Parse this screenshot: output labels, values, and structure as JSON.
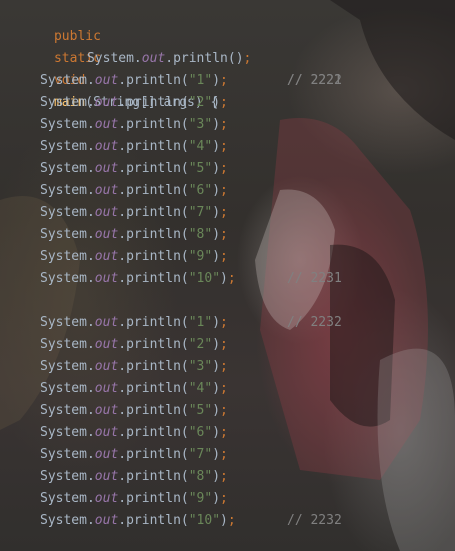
{
  "signature": {
    "kw_public": "public",
    "kw_static": "static",
    "kw_void": "void",
    "method": "main",
    "params": "(String[] args) {"
  },
  "first_call": {
    "receiver": "System.",
    "field": "out",
    "method": ".println",
    "args": "()",
    "semi": ";",
    "comment": "// 2221"
  },
  "block1": {
    "comment_first": "// 2222",
    "comment_last": "// 2231",
    "lines": [
      {
        "arg": "\"1\""
      },
      {
        "arg": "\"2\""
      },
      {
        "arg": "\"3\""
      },
      {
        "arg": "\"4\""
      },
      {
        "arg": "\"5\""
      },
      {
        "arg": "\"6\""
      },
      {
        "arg": "\"7\""
      },
      {
        "arg": "\"8\""
      },
      {
        "arg": "\"9\""
      },
      {
        "arg": "\"10\""
      }
    ]
  },
  "block2": {
    "comment_first": "// 2232",
    "comment_last": "// 2232",
    "lines": [
      {
        "arg": "\"1\""
      },
      {
        "arg": "\"2\""
      },
      {
        "arg": "\"3\""
      },
      {
        "arg": "\"4\""
      },
      {
        "arg": "\"5\""
      },
      {
        "arg": "\"6\""
      },
      {
        "arg": "\"7\""
      },
      {
        "arg": "\"8\""
      },
      {
        "arg": "\"9\""
      },
      {
        "arg": "\"10\""
      }
    ]
  },
  "call_parts": {
    "receiver": "System.",
    "field": "out",
    "method": ".println(",
    "close": ")",
    "semi": ";"
  },
  "closing_brace": "}",
  "colors": {
    "keyword": "#cc7832",
    "method_decl": "#ffc66d",
    "static_field": "#9876aa",
    "string": "#6a8759",
    "comment": "#808080",
    "text": "#a9b7c6"
  }
}
